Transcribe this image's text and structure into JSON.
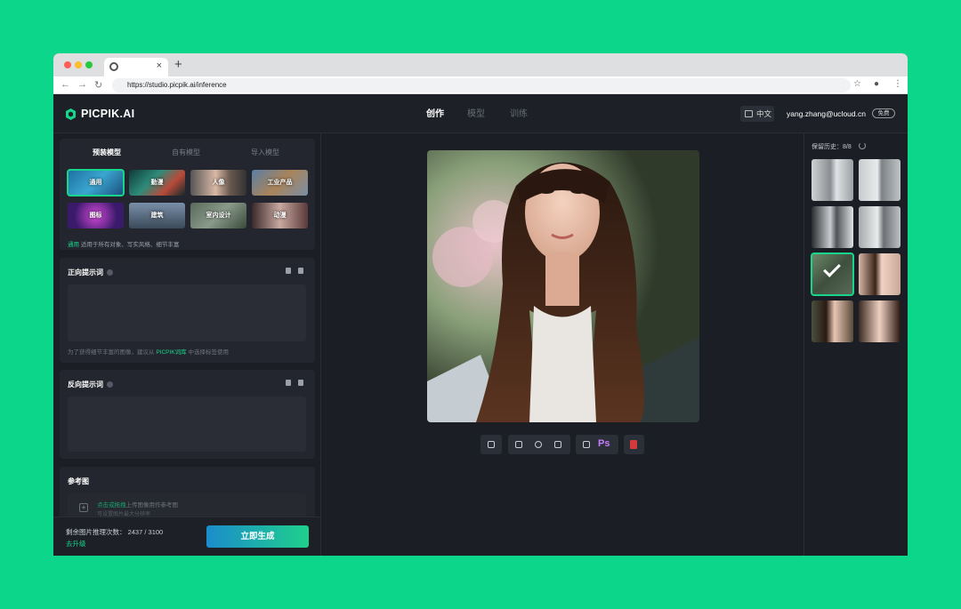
{
  "browser": {
    "url": "https://studio.picpik.ai/inference",
    "tab_close": "×",
    "new_tab": "+"
  },
  "header": {
    "logo": "PICPIK.AI",
    "tabs": [
      {
        "label": "创作",
        "active": true
      },
      {
        "label": "模型",
        "active": false
      },
      {
        "label": "训练",
        "active": false
      }
    ],
    "language": "中文",
    "user_email": "yang.zhang@ucloud.cn",
    "plan_badge": "免费"
  },
  "model_panel": {
    "tabs": [
      {
        "label": "预装模型",
        "active": true
      },
      {
        "label": "自有模型",
        "active": false
      },
      {
        "label": "导入模型",
        "active": false
      }
    ],
    "models": [
      {
        "label": "通用",
        "selected": true
      },
      {
        "label": "動漫",
        "selected": false
      },
      {
        "label": "人像",
        "selected": false
      },
      {
        "label": "工业产品",
        "selected": false
      },
      {
        "label": "图标",
        "selected": false
      },
      {
        "label": "建筑",
        "selected": false
      },
      {
        "label": "室内设计",
        "selected": false
      },
      {
        "label": "动漫",
        "selected": false
      }
    ],
    "selected_name": "通用",
    "selected_desc": "适用于所有对象、写实风格、细节丰富"
  },
  "positive_prompt": {
    "title": "正向提示词",
    "value": "",
    "hint_prefix": "为了获得细节丰富的图像，建议从",
    "hint_link": "PICPIK词库",
    "hint_suffix": "中选择标签使用"
  },
  "negative_prompt": {
    "title": "反向提示词",
    "value": ""
  },
  "reference": {
    "title": "参考图",
    "upload_link": "点击或拖拽",
    "upload_text": "上传图像用作参考图",
    "upload_sub": "可设置图片最大分辨率"
  },
  "footer": {
    "quota_label": "剩余图片推理次数：",
    "quota_value": "2437 / 3100",
    "upgrade": "去升级",
    "generate": "立即生成"
  },
  "toolbar": {
    "ps_label": "Ps"
  },
  "history": {
    "title": "保留历史：",
    "count": "8/8",
    "selected_index": 4
  },
  "colors": {
    "accent": "#17d68c",
    "background": "#0bd68a",
    "app_bg": "#1b1e25",
    "delete": "#d33a3a"
  }
}
